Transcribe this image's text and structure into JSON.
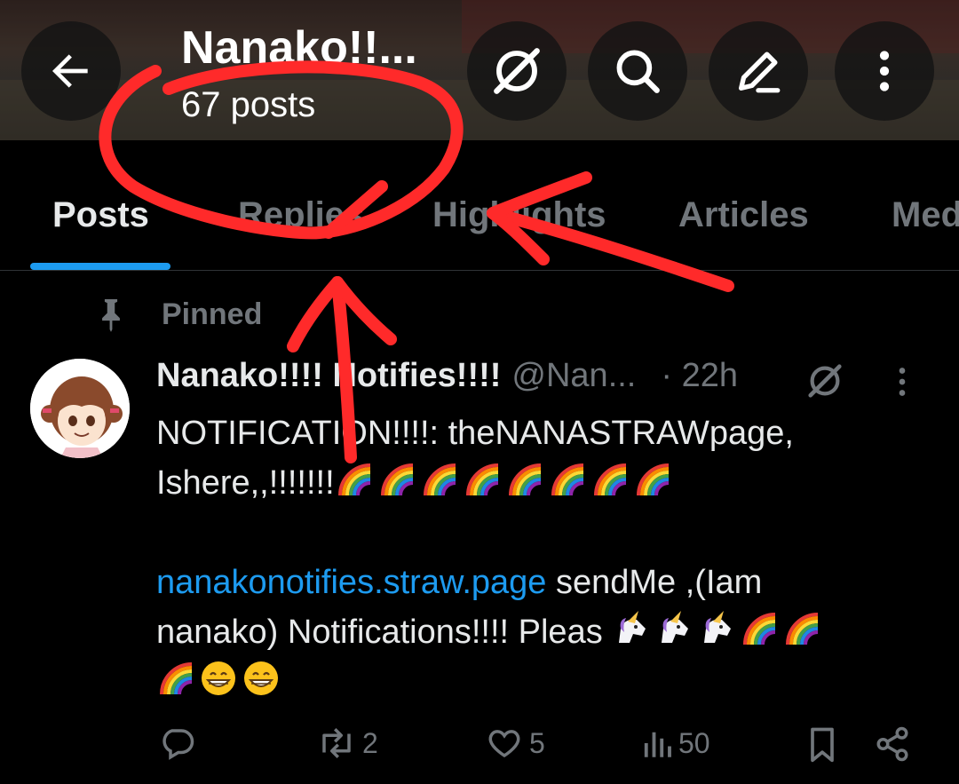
{
  "header": {
    "title": "Nanako!!...",
    "post_count": "67 posts",
    "icons": {
      "back": "arrow-left-icon",
      "grok": "grok-icon",
      "search": "search-icon",
      "compose": "compose-icon",
      "more": "more-vertical-icon"
    }
  },
  "tabs": [
    {
      "label": "Posts",
      "active": true
    },
    {
      "label": "Replies",
      "active": false
    },
    {
      "label": "Highlights",
      "active": false
    },
    {
      "label": "Articles",
      "active": false
    },
    {
      "label": "Media",
      "active": false
    }
  ],
  "pinned": {
    "label": "Pinned",
    "icon": "pin-icon"
  },
  "post": {
    "display_name": "Nanako!!!! Notifies!!!!",
    "handle": "@Nan...",
    "time": "· 22h",
    "line1": "NOTIFICATION!!!!: theNANASTRAWpage,",
    "line2": "Ishere,,!!!!!!!",
    "link": "nanakonotifies.straw.page",
    "line3_rest": " sendMe ,(Iam",
    "line4": "nanako) Notifications!!!! Pleas ",
    "emoji": {
      "rainbow": "rainbow",
      "unicorn": "unicorn",
      "grin": "grinning-face"
    },
    "actions": {
      "replies": "",
      "reposts": "2",
      "likes": "5",
      "views": "50"
    }
  },
  "colors": {
    "accent": "#1d9bf0",
    "muted": "#71767b",
    "annotation": "#ff2a2a"
  }
}
